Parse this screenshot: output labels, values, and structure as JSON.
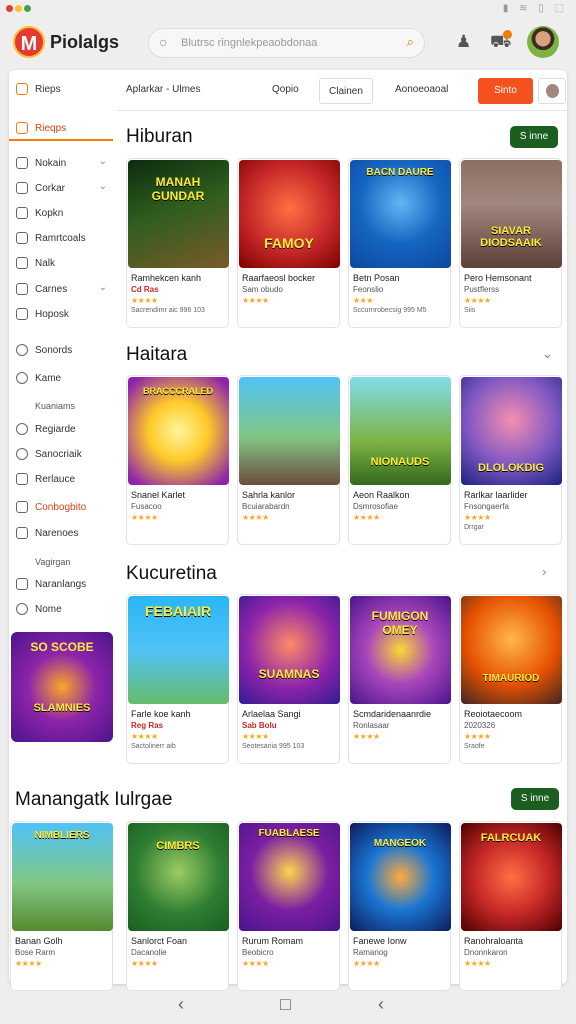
{
  "status": {
    "icons": "▮ ≋ ▯ ⬚"
  },
  "header": {
    "brand": "Piolalgs",
    "logo_letter": "M",
    "search_placeholder": "Blutrsc ringnlekpeaobdonaa"
  },
  "sidebar": {
    "items": [
      {
        "label": "Rieps"
      },
      {
        "label": "Rieqps"
      },
      {
        "label": "Nokain"
      },
      {
        "label": "Corkar"
      },
      {
        "label": "Kopkn"
      },
      {
        "label": "Ramrtcoals"
      },
      {
        "label": "Nalk"
      },
      {
        "label": "Carnes"
      },
      {
        "label": "Hoposk"
      },
      {
        "label": "Sonords"
      },
      {
        "label": "Kame"
      },
      {
        "label": "Regiarde"
      },
      {
        "label": "Sanocriaik"
      },
      {
        "label": "Rerlauce"
      },
      {
        "label": "Conbogbito"
      },
      {
        "label": "Narenoes"
      },
      {
        "label": "Naranlangs"
      },
      {
        "label": "Nome"
      }
    ],
    "subs": {
      "kame": "Kuaniams",
      "narenoes": "Vagirgan"
    },
    "promo": {
      "top": "SO SCOBE",
      "bottom": "SLAMNIES"
    }
  },
  "tabs": {
    "t1": "Aplarkar - Ulmes",
    "t2": "Qopio",
    "t3": "Clainen",
    "t4": "Aonoeoaoal",
    "cta": "Sinto"
  },
  "sections": [
    {
      "title": "Hiburan",
      "pill": "S inne",
      "cards": [
        {
          "art": "MANAH GUNDAR",
          "l1": "Ramhekcen kanh",
          "l2": "Cd Ras",
          "stars": "★★★★",
          "l3": "Sacrendimr aic   996 103"
        },
        {
          "art": "FAMOY",
          "l1": "Raarfaeosl bocker",
          "l2": "Sam obudo",
          "stars": "★★★★",
          "l3": ""
        },
        {
          "art": "BACN DAURE",
          "l1": "Betn Posan",
          "l2": "Feonslio",
          "stars": "★★★",
          "l3": "Sccurnrobecsig   995 M5"
        },
        {
          "art": "SIAVAR DIODSAAIK",
          "l1": "Pero Hemsonant",
          "l2": "Pustflerss",
          "stars": "★★★★",
          "l3": "Siis"
        }
      ]
    },
    {
      "title": "Haitara",
      "pill": "",
      "cards": [
        {
          "art": "BRACCCRALED",
          "l1": "Snanel Karlet",
          "l2": "Fusacoo",
          "stars": "★★★★",
          "l3": ""
        },
        {
          "art": "",
          "l1": "Sahrla kanlor",
          "l2": "Bcuiarabardn",
          "stars": "★★★★",
          "l3": ""
        },
        {
          "art": "NIONAUDS",
          "l1": "Aeon Raalkon",
          "l2": "Dsmrosofiae",
          "stars": "★★★★",
          "l3": ""
        },
        {
          "art": "DLOLOKDIG",
          "l1": "Rarlkar laarlider",
          "l2": "Fnsongaerfa",
          "stars": "★★★★",
          "l3": "Drrgar"
        }
      ]
    },
    {
      "title": "Kucuretina",
      "pill": "",
      "cards": [
        {
          "art": "FEBAIAIR",
          "l1": "Farle koe kanh",
          "l2": "Reg Ras",
          "stars": "★★★★",
          "l3": "Sactolinerr aib"
        },
        {
          "art": "SUAMNAS",
          "l1": "Arlaelaa Sangi",
          "l2": "Sab Bolu",
          "stars": "★★★★",
          "l3": "Seotesariia   995 103"
        },
        {
          "art": "FUMIGON OMEY",
          "l1": "Scmdaridenaanrdie",
          "l2": "Ronlasaar",
          "stars": "★★★★",
          "l3": ""
        },
        {
          "art": "TIMAURIOD",
          "l1": "Reoiotaecoom",
          "l2": "2020326",
          "stars": "★★★★",
          "l3": "Sraofe"
        }
      ]
    },
    {
      "title": "Manangatk Iulrgae",
      "pill": "S inne",
      "cards": [
        {
          "art": "NIMBLIERS",
          "l1": "Banan Golh",
          "l2": "Bose Rarm",
          "stars": "★★★★",
          "l3": ""
        },
        {
          "art": "CIMBRS",
          "l1": "Sanlorct Foan",
          "l2": "Dacanolie",
          "stars": "★★★★",
          "l3": ""
        },
        {
          "art": "FUABLAESE",
          "l1": "Rurum Romam",
          "l2": "Beobicro",
          "stars": "★★★★",
          "l3": ""
        },
        {
          "art": "MANGEOK",
          "l1": "Fanewe Ionw",
          "l2": "Ramanog",
          "stars": "★★★★",
          "l3": ""
        },
        {
          "art": "FALRCUAK",
          "l1": "Ranohraloanta",
          "l2": "Dnonnkaron",
          "stars": "★★★★",
          "l3": ""
        }
      ]
    }
  ],
  "navbar": {
    "back": "‹",
    "home": "□",
    "recent": "‹"
  }
}
